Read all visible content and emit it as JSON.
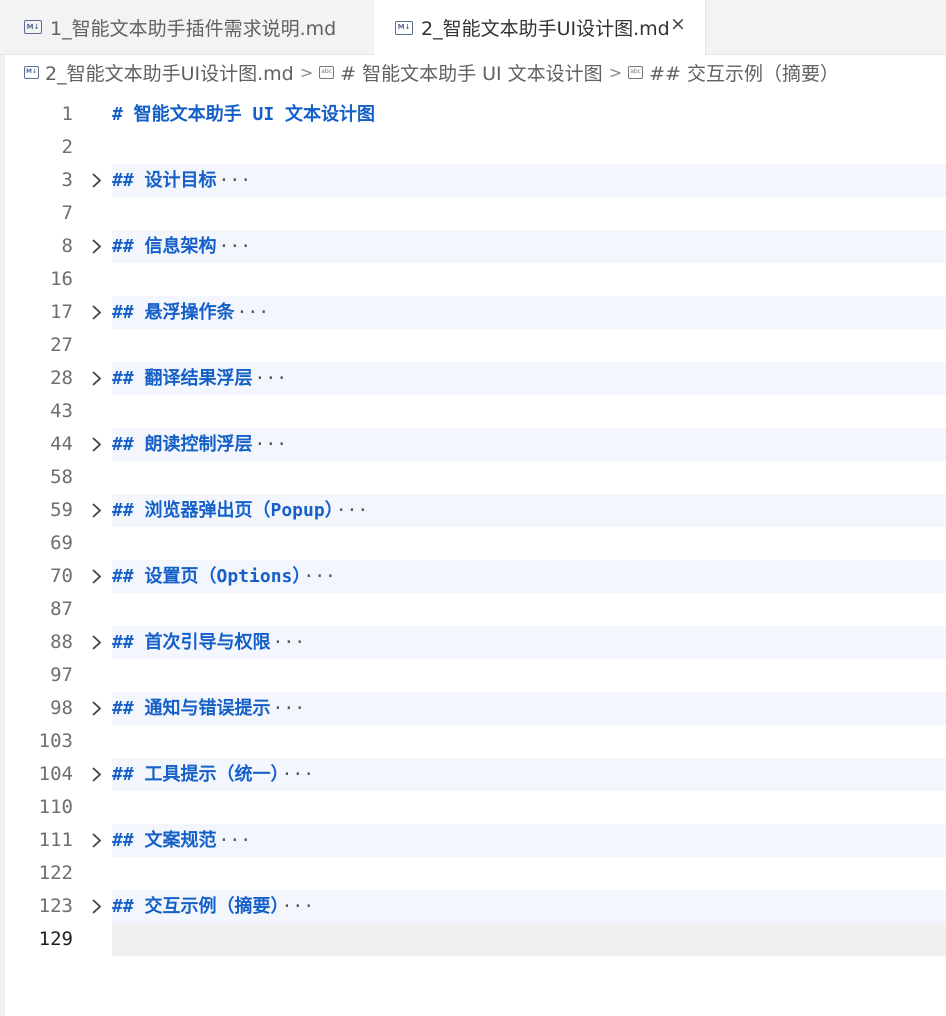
{
  "tabs": [
    {
      "label": "1_智能文本助手插件需求说明.md",
      "icon": "markdown-icon",
      "active": false
    },
    {
      "label": "2_智能文本助手UI设计图.md",
      "icon": "markdown-icon",
      "active": true,
      "close": "×"
    }
  ],
  "breadcrumb": [
    {
      "label": "2_智能文本助手UI设计图.md",
      "icon": "markdown-icon"
    },
    {
      "label": "# 智能文本助手 UI 文本设计图",
      "icon": "symbol-string-icon"
    },
    {
      "label": "## 交互示例（摘要）",
      "icon": "symbol-string-icon"
    }
  ],
  "lines": [
    {
      "num": "1",
      "text": "# 智能文本助手 UI 文本设计图",
      "folded": false
    },
    {
      "num": "2",
      "text": "",
      "folded": false
    },
    {
      "num": "3",
      "text": "## 设计目标",
      "folded": true
    },
    {
      "num": "7",
      "text": "",
      "folded": false
    },
    {
      "num": "8",
      "text": "## 信息架构",
      "folded": true
    },
    {
      "num": "16",
      "text": "",
      "folded": false
    },
    {
      "num": "17",
      "text": "## 悬浮操作条",
      "folded": true
    },
    {
      "num": "27",
      "text": "",
      "folded": false
    },
    {
      "num": "28",
      "text": "## 翻译结果浮层",
      "folded": true
    },
    {
      "num": "43",
      "text": "",
      "folded": false
    },
    {
      "num": "44",
      "text": "## 朗读控制浮层",
      "folded": true
    },
    {
      "num": "58",
      "text": "",
      "folded": false
    },
    {
      "num": "59",
      "text": "## 浏览器弹出页（Popup）",
      "folded": true
    },
    {
      "num": "69",
      "text": "",
      "folded": false
    },
    {
      "num": "70",
      "text": "## 设置页（Options）",
      "folded": true
    },
    {
      "num": "87",
      "text": "",
      "folded": false
    },
    {
      "num": "88",
      "text": "## 首次引导与权限",
      "folded": true
    },
    {
      "num": "97",
      "text": "",
      "folded": false
    },
    {
      "num": "98",
      "text": "## 通知与错误提示",
      "folded": true
    },
    {
      "num": "103",
      "text": "",
      "folded": false
    },
    {
      "num": "104",
      "text": "## 工具提示（统一）",
      "folded": true
    },
    {
      "num": "110",
      "text": "",
      "folded": false
    },
    {
      "num": "111",
      "text": "## 文案规范",
      "folded": true
    },
    {
      "num": "122",
      "text": "",
      "folded": false
    },
    {
      "num": "123",
      "text": "## 交互示例（摘要）",
      "folded": true
    },
    {
      "num": "129",
      "text": "",
      "folded": false,
      "current": true
    }
  ],
  "ellipsis": "···",
  "colors": {
    "heading": "#1560c8",
    "folded_bg": "#f3f7fd",
    "current_line_bg": "#f0f0f0"
  }
}
